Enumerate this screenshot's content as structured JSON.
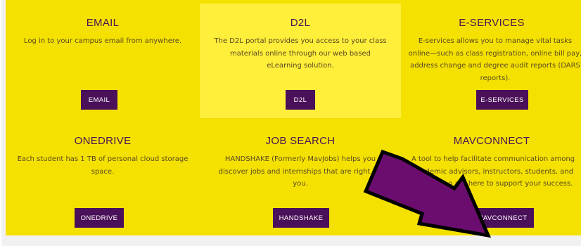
{
  "tiles": [
    {
      "title": "EMAIL",
      "description": "Log in to your campus email from anywhere.",
      "button_label": "EMAIL"
    },
    {
      "title": "D2L",
      "description": "The D2L portal provides you access to your class materials online through our web based eLearning solution.",
      "button_label": "D2L"
    },
    {
      "title": "E-SERVICES",
      "description": "E-services allows you to manage vital tasks online—such as class registration, online bill pay, address change and degree audit reports (DARS reports).",
      "button_label": "E-SERVICES"
    },
    {
      "title": "ONEDRIVE",
      "description": "Each student has 1 TB of personal cloud storage space.",
      "button_label": "ONEDRIVE"
    },
    {
      "title": "JOB SEARCH",
      "description": "HANDSHAKE (Formerly MavJobs) helps you discover jobs and internships that are right for you.",
      "button_label": "HANDSHAKE"
    },
    {
      "title": "MAVCONNECT",
      "description": "A tool to help facilitate communication among academic advisors, instructors, students, and others who are here to support your success.",
      "button_label": "MAVCONNECT"
    }
  ],
  "colors": {
    "panel": "#f4e100",
    "panel_highlight": "#ffee3a",
    "button": "#4a1059",
    "title": "#4a1550",
    "arrow": "#6b0d6e"
  }
}
